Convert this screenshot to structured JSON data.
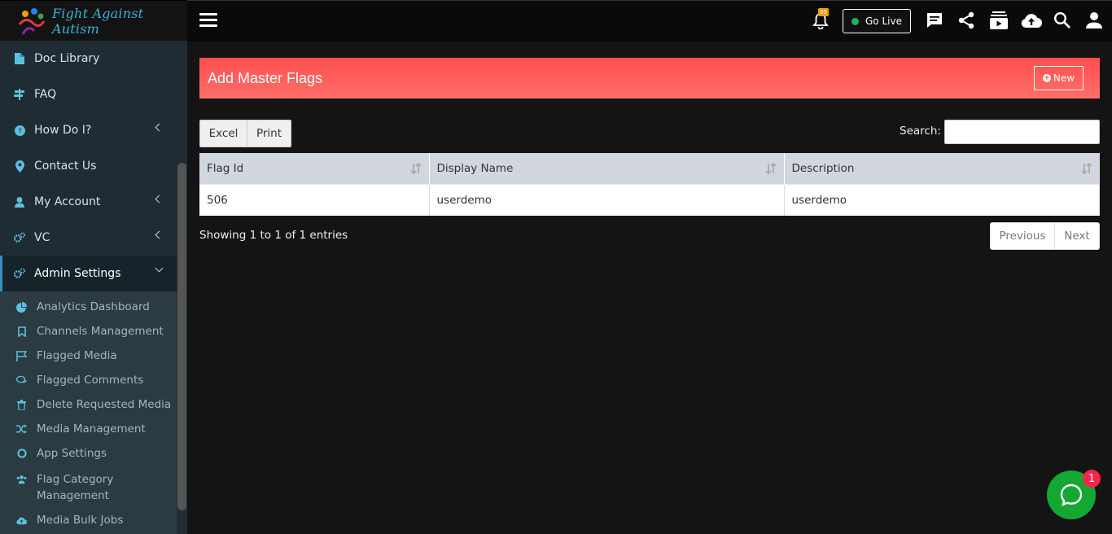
{
  "brand": {
    "name": "Fight Against Autism"
  },
  "sidebar": {
    "items": [
      {
        "label": "Doc Library",
        "icon": "file-icon"
      },
      {
        "label": "FAQ",
        "icon": "signpost-icon"
      },
      {
        "label": "How Do I?",
        "icon": "question-circle-icon"
      },
      {
        "label": "Contact Us",
        "icon": "map-marker-icon"
      },
      {
        "label": "My Account",
        "icon": "user-icon"
      },
      {
        "label": "VC",
        "icon": "cogs-icon"
      },
      {
        "label": "Admin Settings",
        "icon": "cogs-icon"
      }
    ],
    "submenu": [
      {
        "label": "Analytics Dashboard",
        "icon": "pie-chart-icon"
      },
      {
        "label": "Channels Management",
        "icon": "bookmark-icon"
      },
      {
        "label": "Flagged Media",
        "icon": "flag-icon"
      },
      {
        "label": "Flagged Comments",
        "icon": "comments-icon"
      },
      {
        "label": "Delete Requested Media",
        "icon": "trash-icon"
      },
      {
        "label": "Media Management",
        "icon": "random-icon"
      },
      {
        "label": "App Settings",
        "icon": "circle-icon"
      },
      {
        "label": "Flag Category Management",
        "icon": "users-icon"
      },
      {
        "label": "Media Bulk Jobs",
        "icon": "cloud-upload-icon"
      }
    ]
  },
  "topbar": {
    "notification_count": "35",
    "go_live_label": "Go Live",
    "accent": "#1fb45a"
  },
  "panel": {
    "title": "Add Master Flags",
    "new_label": "New",
    "header_color": "#ff5a55"
  },
  "table_tools": {
    "excel_label": "Excel",
    "print_label": "Print",
    "search_label": "Search:",
    "search_value": ""
  },
  "table": {
    "columns": [
      "Flag Id",
      "Display Name",
      "Description"
    ],
    "rows": [
      [
        "506",
        "userdemo",
        "userdemo"
      ]
    ]
  },
  "pagination": {
    "info": "Showing 1 to 1 of 1 entries",
    "previous_label": "Previous",
    "next_label": "Next"
  },
  "chat": {
    "badge": "1"
  }
}
